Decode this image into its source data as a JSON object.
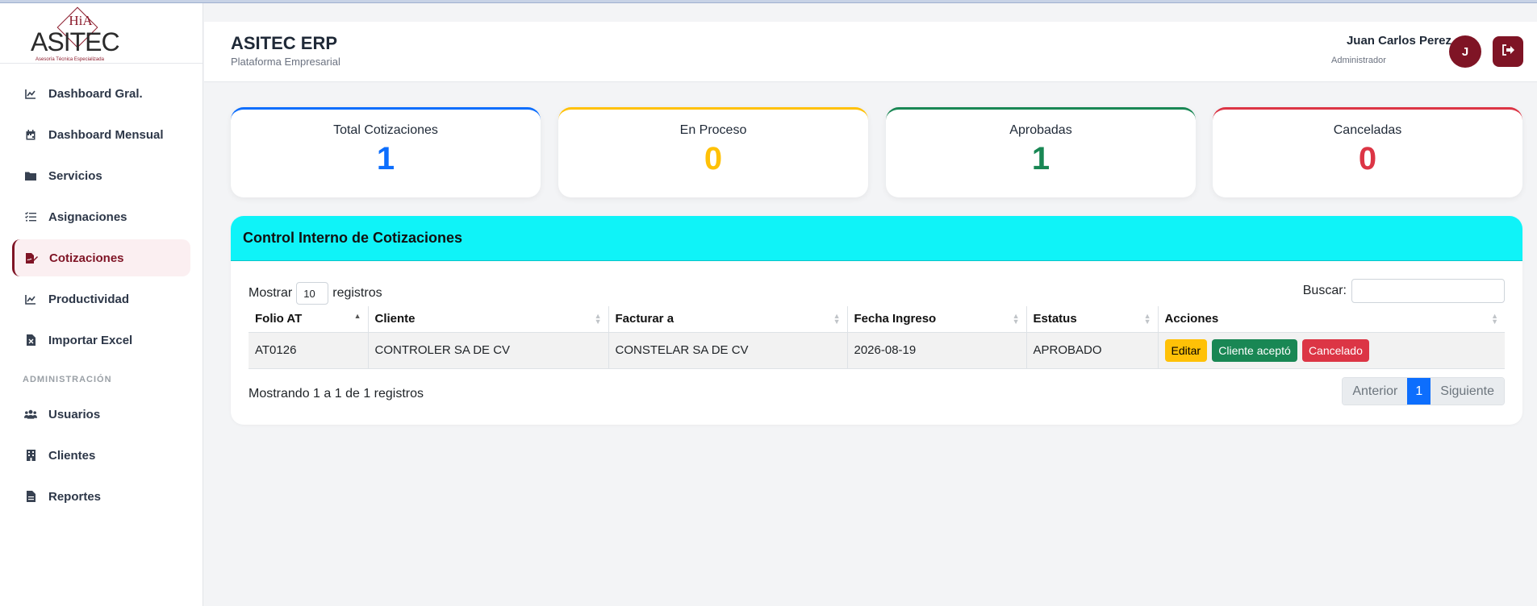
{
  "brand": {
    "logo_text": "ASITEC",
    "logo_mark": "HiA",
    "logo_tagline": "Asesoría Técnica Especializada"
  },
  "sidebar": {
    "items": [
      {
        "label": "Dashboard Gral.",
        "icon": "chart-line-icon"
      },
      {
        "label": "Dashboard Mensual",
        "icon": "calendar-icon"
      },
      {
        "label": "Servicios",
        "icon": "folder-icon"
      },
      {
        "label": "Asignaciones",
        "icon": "list-check-icon"
      },
      {
        "label": "Cotizaciones",
        "icon": "file-signature-icon",
        "active": true
      },
      {
        "label": "Productividad",
        "icon": "chart-line-icon"
      },
      {
        "label": "Importar Excel",
        "icon": "file-excel-icon"
      }
    ],
    "admin_label": "ADMINISTRACIÓN",
    "admin_items": [
      {
        "label": "Usuarios",
        "icon": "users-icon"
      },
      {
        "label": "Clientes",
        "icon": "building-icon"
      },
      {
        "label": "Reportes",
        "icon": "file-icon"
      }
    ]
  },
  "header": {
    "title": "ASITEC ERP",
    "subtitle": "Plataforma Empresarial",
    "user_name": "Juan Carlos Perez",
    "user_role": "Administrador",
    "avatar_initial": "J"
  },
  "stats": [
    {
      "label": "Total Cotizaciones",
      "value": "1",
      "color": "#0d6efd"
    },
    {
      "label": "En Proceso",
      "value": "0",
      "color": "#ffc107"
    },
    {
      "label": "Aprobadas",
      "value": "1",
      "color": "#198754"
    },
    {
      "label": "Canceladas",
      "value": "0",
      "color": "#dc3545"
    }
  ],
  "panel": {
    "title": "Control Interno de Cotizaciones",
    "show_prefix": "Mostrar",
    "show_value": "10",
    "show_suffix": "registros",
    "search_label": "Buscar:",
    "search_value": "",
    "columns": [
      "Folio AT",
      "Cliente",
      "Facturar a",
      "Fecha Ingreso",
      "Estatus",
      "Acciones"
    ],
    "rows": [
      {
        "folio": "AT0126",
        "cliente": "CONTROLER SA DE CV",
        "facturar": "CONSTELAR SA DE CV",
        "fecha": "2026-08-19",
        "estatus": "APROBADO",
        "actions": [
          "Editar",
          "Cliente aceptó",
          "Cancelado"
        ]
      }
    ],
    "info": "Mostrando 1 a 1 de 1 registros",
    "pager": {
      "prev": "Anterior",
      "current": "1",
      "next": "Siguiente"
    }
  }
}
